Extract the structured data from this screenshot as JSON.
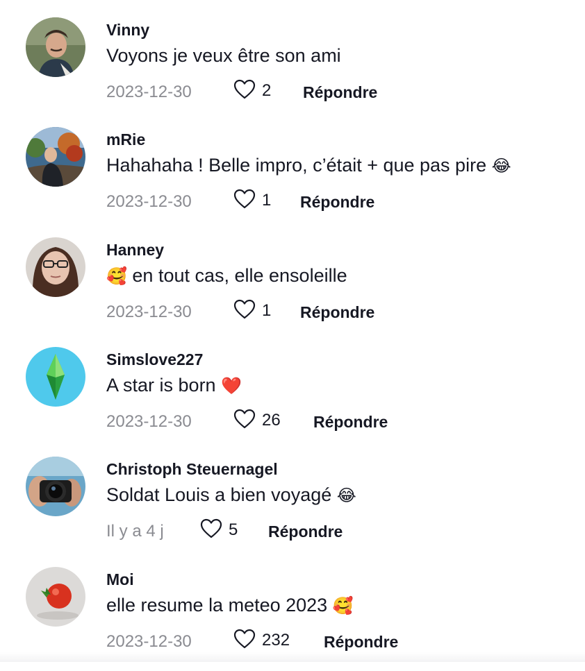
{
  "comments": [
    {
      "username": "Vinny",
      "text": "Voyons je veux être son ami",
      "emoji": "",
      "date": "2023-12-30",
      "likes": "2",
      "reply_label": "Répondre"
    },
    {
      "username": "mRie",
      "text": "Hahahaha ! Belle impro, c’était + que pas pire",
      "emoji": "😂",
      "date": "2023-12-30",
      "likes": "1",
      "reply_label": "Répondre"
    },
    {
      "username": "Hanney",
      "text": "en tout cas, elle ensoleille",
      "emoji": "🥰",
      "date": "2023-12-30",
      "likes": "1",
      "reply_label": "Répondre"
    },
    {
      "username": "Simslove227",
      "text": "A star is born",
      "emoji": "❤️",
      "date": "2023-12-30",
      "likes": "26",
      "reply_label": "Répondre"
    },
    {
      "username": "Christoph Steuernagel",
      "text": "Soldat Louis a bien voyagé",
      "emoji": "😂",
      "date": "Il y a 4 j",
      "likes": "5",
      "reply_label": "Répondre"
    },
    {
      "username": "Moi",
      "text": "elle resume la meteo 2023",
      "emoji": "🥰",
      "date": "2023-12-30",
      "likes": "232",
      "reply_label": "Répondre"
    }
  ],
  "icons": {
    "like": "heart-outline-icon"
  },
  "colors": {
    "text": "#161823",
    "muted": "#8a8b91"
  }
}
